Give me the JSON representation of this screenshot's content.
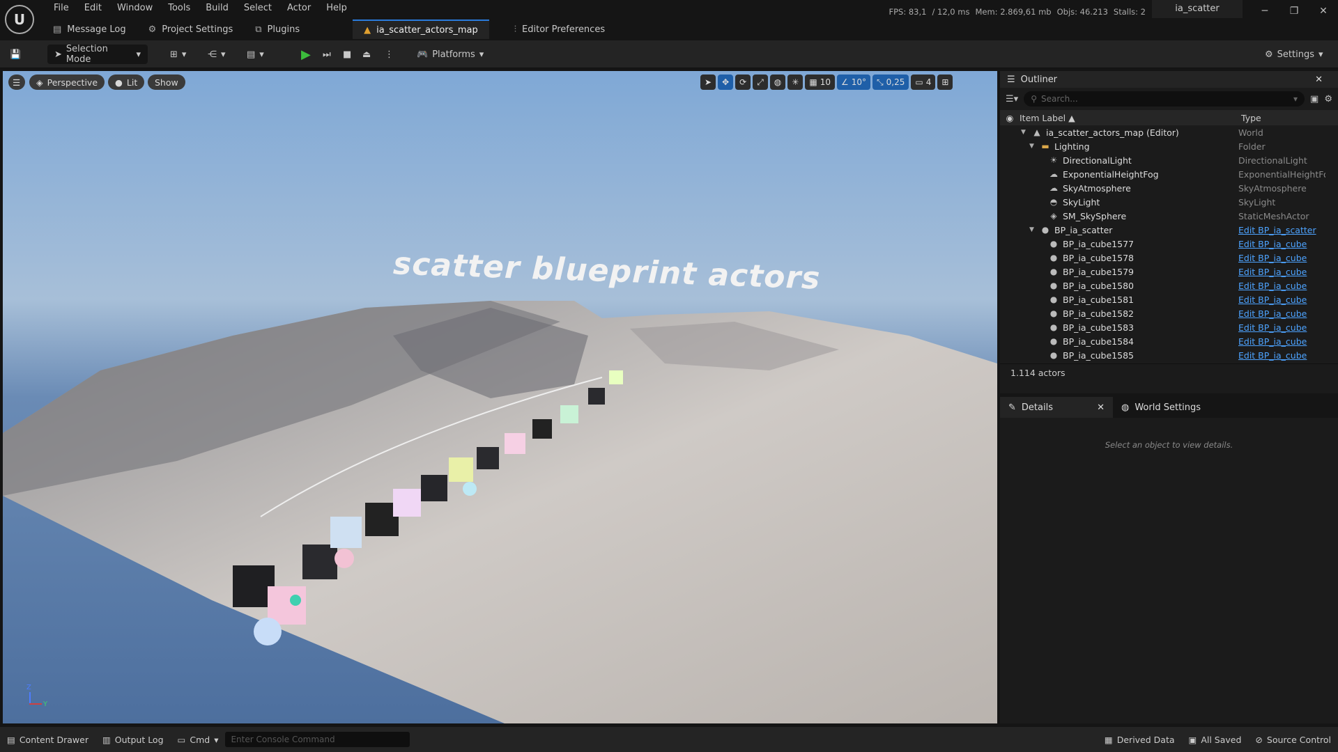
{
  "app": {
    "logo": "U",
    "project": "ia_scatter"
  },
  "menu": [
    "File",
    "Edit",
    "Window",
    "Tools",
    "Build",
    "Select",
    "Actor",
    "Help"
  ],
  "stats": {
    "fps": "FPS: 83,1",
    "ms": "/ 12,0 ms",
    "mem": "Mem: 2.869,61 mb",
    "objs": "Objs: 46.213",
    "stalls": "Stalls: 2"
  },
  "window_controls": {
    "minimize": "─",
    "restore": "❐",
    "close": "✕"
  },
  "tabs": [
    {
      "label": "Message Log",
      "icon": "message-log-icon"
    },
    {
      "label": "Project Settings",
      "icon": "settings-icon"
    },
    {
      "label": "Plugins",
      "icon": "plugin-icon"
    },
    {
      "label": "ia_scatter_actors_map",
      "icon": "level-icon",
      "active": true
    },
    {
      "label": "Editor Preferences",
      "icon": "sliders-icon"
    }
  ],
  "toolbar": {
    "mode": "Selection Mode",
    "platforms": "Platforms",
    "settings": "Settings"
  },
  "viewport": {
    "perspective": "Perspective",
    "lit": "Lit",
    "show": "Show",
    "grid_size": "10",
    "angle": "10°",
    "scale": "0,25",
    "camera_speed": "4",
    "scene_text": "scatter blueprint actors",
    "axis_z": "Z",
    "axis_y": "Y"
  },
  "outliner": {
    "title": "Outliner",
    "search_placeholder": "Search...",
    "col_label": "Item Label ▲",
    "col_type": "Type",
    "rows": [
      {
        "label": "ia_scatter_actors_map (Editor)",
        "type": "World",
        "indent": 0,
        "arrow": "▼",
        "icon": "▲",
        "link": false
      },
      {
        "label": "Lighting",
        "type": "Folder",
        "indent": 1,
        "arrow": "▼",
        "icon": "▬",
        "link": false
      },
      {
        "label": "DirectionalLight",
        "type": "DirectionalLight",
        "indent": 2,
        "arrow": "",
        "icon": "☀",
        "link": false
      },
      {
        "label": "ExponentialHeightFog",
        "type": "ExponentialHeightFog",
        "indent": 2,
        "arrow": "",
        "icon": "☁",
        "link": false
      },
      {
        "label": "SkyAtmosphere",
        "type": "SkyAtmosphere",
        "indent": 2,
        "arrow": "",
        "icon": "☁",
        "link": false
      },
      {
        "label": "SkyLight",
        "type": "SkyLight",
        "indent": 2,
        "arrow": "",
        "icon": "◓",
        "link": false
      },
      {
        "label": "SM_SkySphere",
        "type": "StaticMeshActor",
        "indent": 2,
        "arrow": "",
        "icon": "◈",
        "link": false
      },
      {
        "label": "BP_ia_scatter",
        "type": "Edit BP_ia_scatter",
        "indent": 1,
        "arrow": "▼",
        "icon": "●",
        "link": true
      },
      {
        "label": "BP_ia_cube1577",
        "type": "Edit BP_ia_cube",
        "indent": 2,
        "arrow": "",
        "icon": "●",
        "link": true
      },
      {
        "label": "BP_ia_cube1578",
        "type": "Edit BP_ia_cube",
        "indent": 2,
        "arrow": "",
        "icon": "●",
        "link": true
      },
      {
        "label": "BP_ia_cube1579",
        "type": "Edit BP_ia_cube",
        "indent": 2,
        "arrow": "",
        "icon": "●",
        "link": true
      },
      {
        "label": "BP_ia_cube1580",
        "type": "Edit BP_ia_cube",
        "indent": 2,
        "arrow": "",
        "icon": "●",
        "link": true
      },
      {
        "label": "BP_ia_cube1581",
        "type": "Edit BP_ia_cube",
        "indent": 2,
        "arrow": "",
        "icon": "●",
        "link": true
      },
      {
        "label": "BP_ia_cube1582",
        "type": "Edit BP_ia_cube",
        "indent": 2,
        "arrow": "",
        "icon": "●",
        "link": true
      },
      {
        "label": "BP_ia_cube1583",
        "type": "Edit BP_ia_cube",
        "indent": 2,
        "arrow": "",
        "icon": "●",
        "link": true
      },
      {
        "label": "BP_ia_cube1584",
        "type": "Edit BP_ia_cube",
        "indent": 2,
        "arrow": "",
        "icon": "●",
        "link": true
      },
      {
        "label": "BP_ia_cube1585",
        "type": "Edit BP_ia_cube",
        "indent": 2,
        "arrow": "",
        "icon": "●",
        "link": true
      }
    ],
    "count": "1.114 actors"
  },
  "details": {
    "tab_details": "Details",
    "tab_world": "World Settings",
    "empty": "Select an object to view details."
  },
  "statusbar": {
    "content_drawer": "Content Drawer",
    "output_log": "Output Log",
    "cmd": "Cmd",
    "console_placeholder": "Enter Console Command",
    "derived_data": "Derived Data",
    "all_saved": "All Saved",
    "source_control": "Source Control"
  },
  "colors": {
    "accent": "#2a7bdc",
    "link": "#4da3ff",
    "play": "#3cbc3c"
  }
}
